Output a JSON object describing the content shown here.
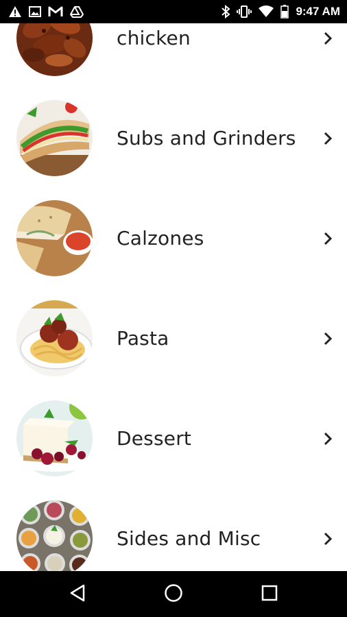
{
  "status_bar": {
    "time": "9:47 AM",
    "left_icons": [
      "warning-icon",
      "image-icon",
      "gmail-icon",
      "drive-icon"
    ],
    "right_icons": [
      "bluetooth-icon",
      "vibrate-icon",
      "wifi-icon",
      "battery-icon"
    ]
  },
  "menu": {
    "items": [
      {
        "label": "chicken",
        "image": "chicken-wings"
      },
      {
        "label": "Subs and Grinders",
        "image": "sub-sandwich"
      },
      {
        "label": "Calzones",
        "image": "calzone"
      },
      {
        "label": "Pasta",
        "image": "pasta-meatballs"
      },
      {
        "label": "Dessert",
        "image": "cheesecake"
      },
      {
        "label": "Sides and Misc",
        "image": "dipping-sauces"
      }
    ]
  },
  "nav_bar": {
    "buttons": [
      "back-icon",
      "home-icon",
      "recents-icon"
    ]
  },
  "colors": {
    "status_bar_bg": "#000000",
    "nav_bar_bg": "#000000",
    "text": "#222222",
    "background": "#ffffff"
  }
}
